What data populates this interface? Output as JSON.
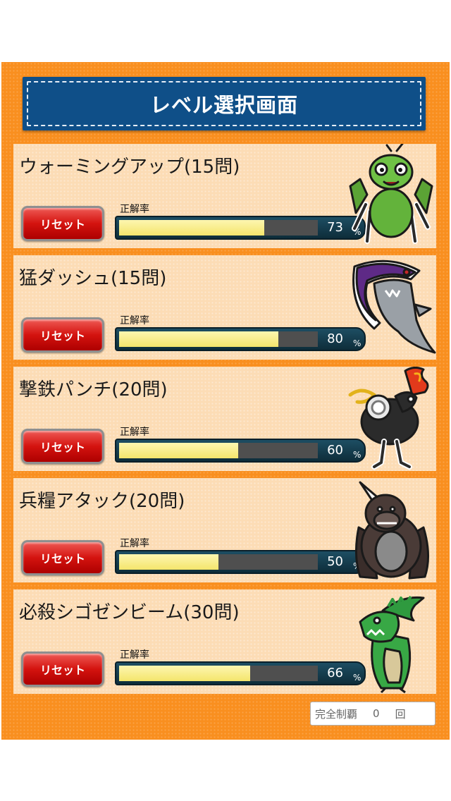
{
  "header": {
    "title": "レベル選択画面"
  },
  "levels": [
    {
      "title": "ウォーミングアップ(15問)",
      "reset_label": "リセット",
      "rate_label": "正解率",
      "rate": 73,
      "unit": "%",
      "monster": "mantis-monster"
    },
    {
      "title": "猛ダッシュ(15問)",
      "reset_label": "リセット",
      "rate_label": "正解率",
      "rate": 80,
      "unit": "%",
      "monster": "shark-monster"
    },
    {
      "title": "撃鉄パンチ(20問)",
      "reset_label": "リセット",
      "rate_label": "正解率",
      "rate": 60,
      "unit": "%",
      "monster": "rooster-monster"
    },
    {
      "title": "兵糧アタック(20問)",
      "reset_label": "リセット",
      "rate_label": "正解率",
      "rate": 50,
      "unit": "%",
      "monster": "gorilla-monster"
    },
    {
      "title": "必殺シゴゼンビーム(30問)",
      "reset_label": "リセット",
      "rate_label": "正解率",
      "rate": 66,
      "unit": "%",
      "monster": "dinosaur-monster"
    }
  ],
  "footer": {
    "label": "完全制覇",
    "count": "0",
    "unit": "回"
  },
  "colors": {
    "background": "#f98f1f",
    "title_bar": "#0f4f88",
    "card": "#fcdcb5",
    "bar_fill": "#f4e56c",
    "reset_button": "#d4130f"
  }
}
